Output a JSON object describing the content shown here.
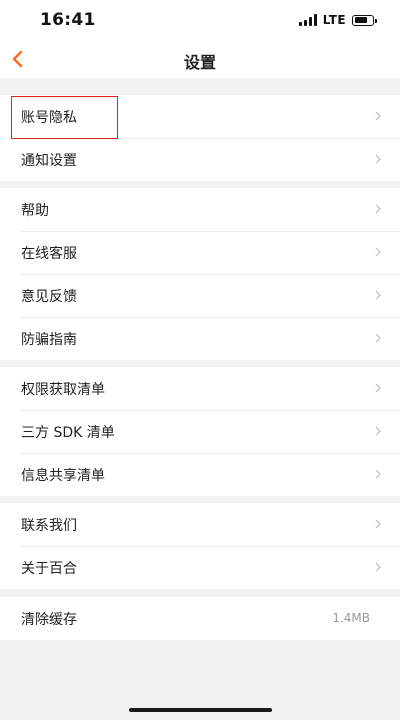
{
  "status": {
    "time": "16:41",
    "network": "LTE",
    "battery_level": 0.75
  },
  "header": {
    "back_icon": "chevron-left-icon",
    "title": "设置"
  },
  "groups": [
    {
      "items": [
        {
          "label": "账号隐私",
          "highlighted": true
        },
        {
          "label": "通知设置"
        }
      ]
    },
    {
      "items": [
        {
          "label": "帮助"
        },
        {
          "label": "在线客服"
        },
        {
          "label": "意见反馈"
        },
        {
          "label": "防骗指南"
        }
      ]
    },
    {
      "items": [
        {
          "label": "权限获取清单"
        },
        {
          "label": "三方 SDK 清单"
        },
        {
          "label": "信息共享清单"
        }
      ]
    },
    {
      "items": [
        {
          "label": "联系我们"
        },
        {
          "label": "关于百合"
        }
      ]
    },
    {
      "items": [
        {
          "label": "清除缓存",
          "value": "1.4MB"
        }
      ]
    }
  ],
  "colors": {
    "accent": "#ff6a1a",
    "highlight_border": "#e0231f",
    "background": "#f2f2f2",
    "chevron": "#c4c4c4"
  }
}
